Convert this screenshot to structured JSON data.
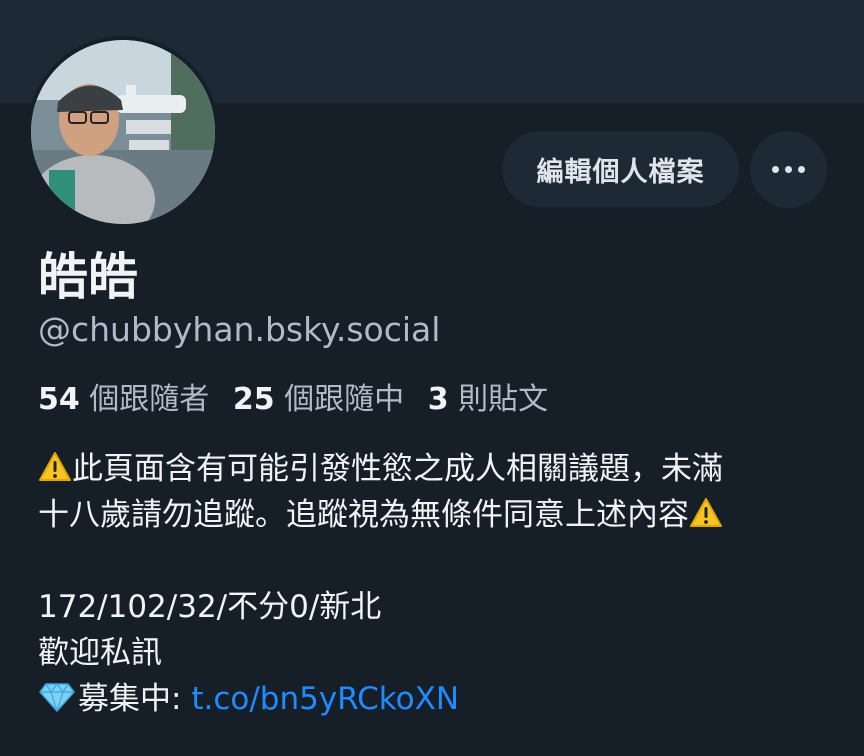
{
  "profile": {
    "display_name": "皓皓",
    "handle": "@chubbyhan.bsky.social"
  },
  "actions": {
    "edit_profile_label": "編輯個人檔案"
  },
  "stats": {
    "followers_count": "54",
    "followers_label": "個跟隨者",
    "following_count": "25",
    "following_label": "個跟隨中",
    "posts_count": "3",
    "posts_label": "則貼文"
  },
  "bio": {
    "warning_line1": "此頁面含有可能引發性慾之成人相關議題，未滿",
    "warning_line2": "十八歲請勿追蹤。追蹤視為無條件同意上述內容",
    "stats_line": "172/102/32/不分0/新北",
    "dm_line": "歡迎私訊",
    "recruit_label": "募集中: ",
    "recruit_link": "t.co/bn5yRCkoXN"
  },
  "icons": {
    "warning": "warning-icon",
    "gem": "gem-icon",
    "more": "ellipsis-icon"
  },
  "colors": {
    "background": "#161e27",
    "banner": "#1e2936",
    "link": "#208bfe",
    "muted_text": "#aebbc9"
  }
}
